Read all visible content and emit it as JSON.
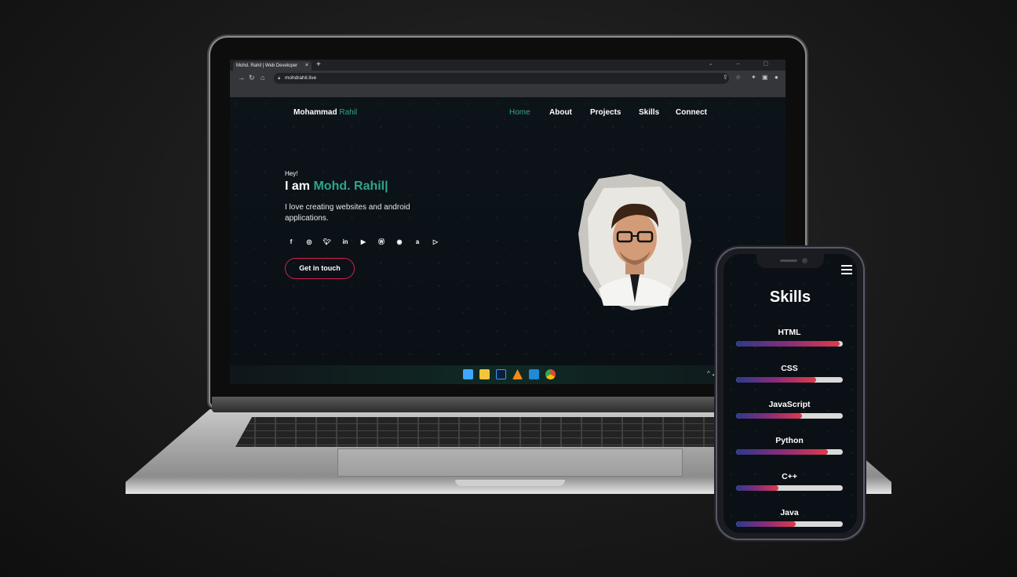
{
  "browser": {
    "tab_title": "Mohd. Rahil | Web Developer",
    "tab_close": "×",
    "new_tab": "+",
    "window_controls": "⌄ – ▢",
    "url": "mohdrahil.live"
  },
  "site": {
    "brand_first": "Mohammad",
    "brand_accent": "Rahil",
    "nav": [
      "Home",
      "About",
      "Projects",
      "Skills",
      "Connect"
    ],
    "active_nav": "Home",
    "greeting": "Hey!",
    "headline_prefix": "I am",
    "headline_name": "Mohd. Rahil|",
    "tagline": "I love creating websites and android applications.",
    "socials": [
      "facebook-icon",
      "instagram-icon",
      "twitter-icon",
      "linkedin-icon",
      "youtube-icon",
      "wordpress-icon",
      "github-icon",
      "amazon-icon",
      "play-store-icon"
    ],
    "cta": "Get in touch"
  },
  "taskbar": {
    "apps": [
      "windows-start-icon",
      "file-explorer-icon",
      "photoshop-icon",
      "vlc-icon",
      "vscode-icon",
      "chrome-icon"
    ]
  },
  "phone": {
    "title": "Skills",
    "skills": [
      {
        "name": "HTML",
        "level": 0.97
      },
      {
        "name": "CSS",
        "level": 0.75
      },
      {
        "name": "JavaScript",
        "level": 0.62
      },
      {
        "name": "Python",
        "level": 0.86
      },
      {
        "name": "C++",
        "level": 0.4
      },
      {
        "name": "Java",
        "level": 0.56
      }
    ]
  },
  "colors": {
    "accent": "#2ea58a",
    "cta_border": "#d81f4f",
    "bar_start": "#2c3a8c",
    "bar_end": "#e03a4a"
  }
}
